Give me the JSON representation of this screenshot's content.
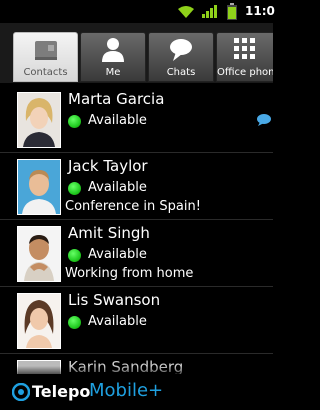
{
  "status_bar": {
    "time": "11:0",
    "icons": [
      "wifi-icon",
      "signal-icon",
      "battery-icon"
    ],
    "accent": "#8fd11a"
  },
  "tabs": [
    {
      "label": "Contacts",
      "icon": "contacts-icon",
      "active": true
    },
    {
      "label": "Me",
      "icon": "person-icon",
      "active": false
    },
    {
      "label": "Chats",
      "icon": "chat-bubble-icon",
      "active": false
    },
    {
      "label": "Office phon",
      "icon": "dialpad-icon",
      "active": false
    }
  ],
  "contacts": [
    {
      "name": "Marta Garcia",
      "status": "Available",
      "note": "",
      "status_color": "#33cc33",
      "has_chat": true
    },
    {
      "name": "Jack Taylor",
      "status": "Available",
      "note": "Conference in Spain!",
      "status_color": "#33cc33",
      "has_chat": false
    },
    {
      "name": "Amit Singh",
      "status": "Available",
      "note": "Working from home",
      "status_color": "#33cc33",
      "has_chat": false
    },
    {
      "name": "Lis Swanson",
      "status": "Available",
      "note": "",
      "status_color": "#33cc33",
      "has_chat": false
    },
    {
      "name": "Karin Sandberg",
      "status": "",
      "note": "",
      "status_color": "#33cc33",
      "has_chat": false
    }
  ],
  "brand": {
    "name": "Telepo",
    "suffix": "Mobile+",
    "color": "#1fa0e0"
  }
}
